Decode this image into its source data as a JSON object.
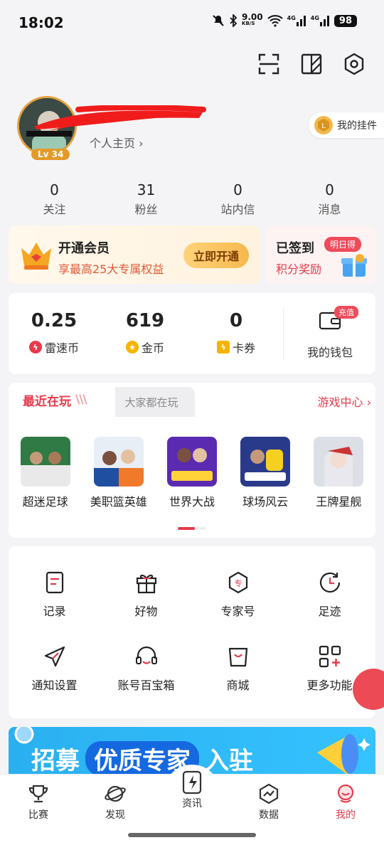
{
  "status_bar": {
    "time": "18:02",
    "net_speed": "9.00",
    "net_unit": "KB/S",
    "sig1": "4G",
    "sig2": "4G",
    "battery": "98"
  },
  "profile": {
    "level": "Lv 34",
    "home_link": "个人主页 ›",
    "pendant_label": "我的挂件"
  },
  "stats": [
    {
      "count": "0",
      "label": "关注"
    },
    {
      "count": "31",
      "label": "粉丝"
    },
    {
      "count": "0",
      "label": "站内信"
    },
    {
      "count": "0",
      "label": "消息"
    }
  ],
  "vip": {
    "title": "开通会员",
    "subtitle": "享最高25大专属权益",
    "button": "立即开通"
  },
  "signin": {
    "title": "已签到",
    "badge": "明日得",
    "subtitle": "积分奖励"
  },
  "wallet": {
    "items": [
      {
        "value": "0.25",
        "label": "雷速币"
      },
      {
        "value": "619",
        "label": "金币"
      },
      {
        "value": "0",
        "label": "卡券"
      }
    ],
    "wallet_label": "我的钱包",
    "recharge_badge": "充值"
  },
  "games": {
    "tab_recent": "最近在玩",
    "tab_others": "大家都在玩",
    "center_link": "游戏中心 ›",
    "list": [
      {
        "name": "超迷足球"
      },
      {
        "name": "美职篮英雄"
      },
      {
        "name": "世界大战"
      },
      {
        "name": "球场风云"
      },
      {
        "name": "王牌星舰"
      }
    ]
  },
  "functions": [
    {
      "label": "记录"
    },
    {
      "label": "好物"
    },
    {
      "label": "专家号"
    },
    {
      "label": "足迹"
    },
    {
      "label": "通知设置"
    },
    {
      "label": "账号百宝箱"
    },
    {
      "label": "商城"
    },
    {
      "label": "更多功能"
    }
  ],
  "banner": {
    "text1": "招募",
    "text2": "优质专家",
    "text3": "入驻"
  },
  "tabbar": [
    {
      "label": "比赛"
    },
    {
      "label": "发现"
    },
    {
      "label": "资讯"
    },
    {
      "label": "数据"
    },
    {
      "label": "我的"
    }
  ],
  "colors": {
    "accent": "#e83a4c",
    "gold": "#e6a23c"
  }
}
